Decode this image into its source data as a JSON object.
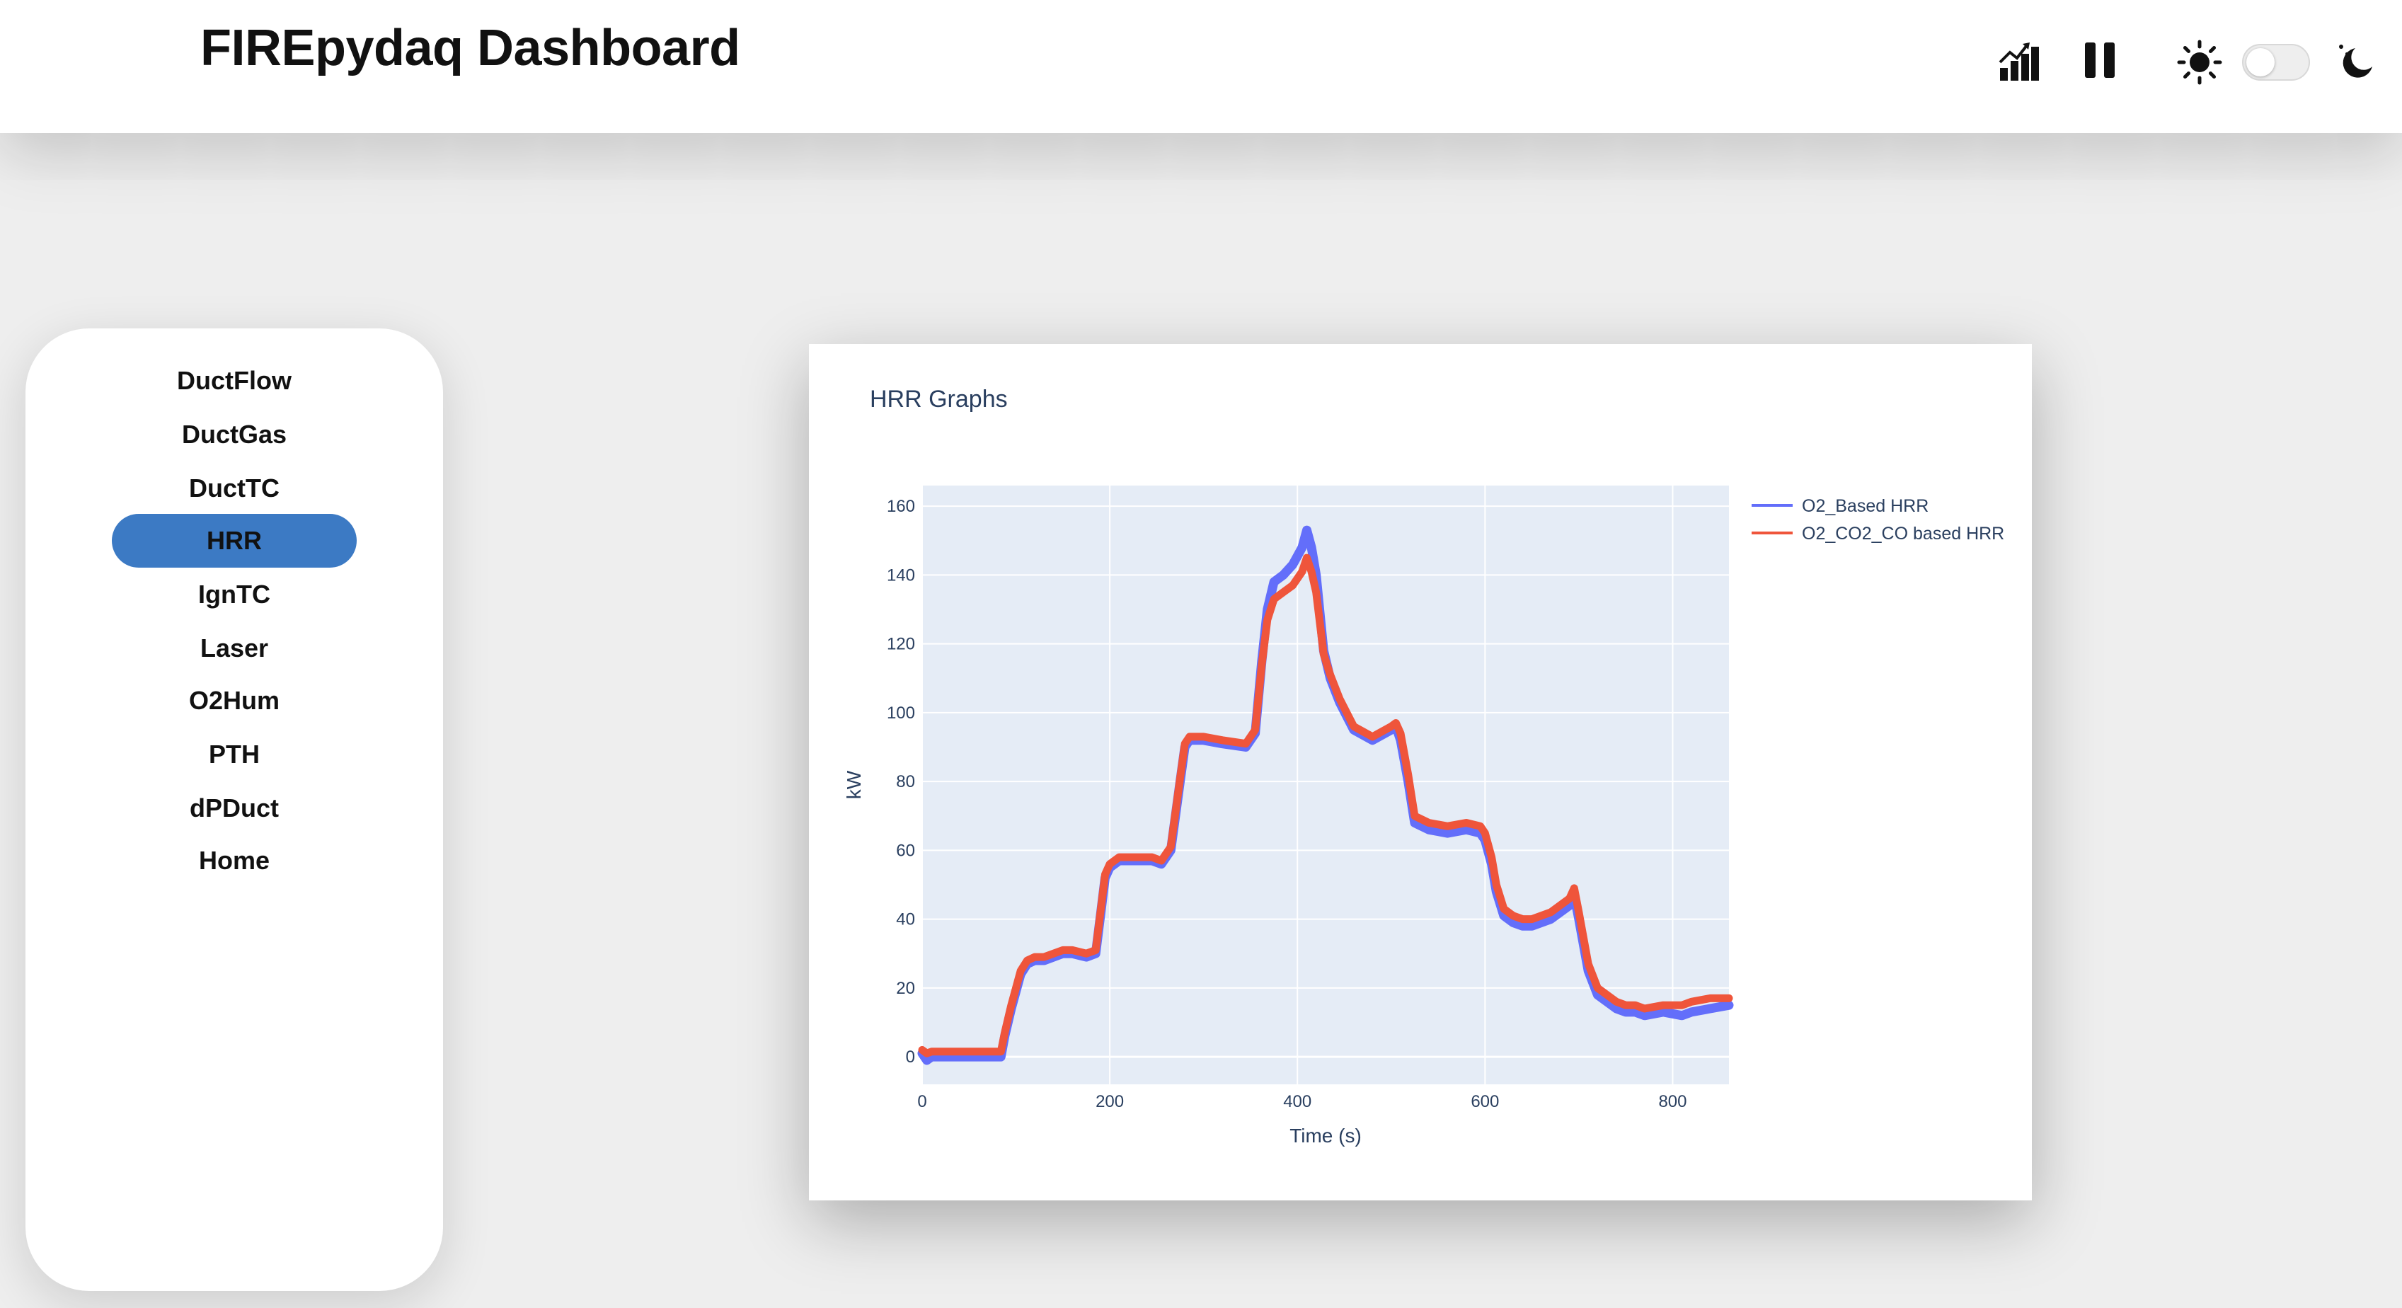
{
  "app": {
    "title": "FIREpydaq Dashboard"
  },
  "header_icons": [
    "bar-chart-icon",
    "pause-icon",
    "sun-icon",
    "theme-toggle",
    "moon-icon"
  ],
  "theme": {
    "dark_mode": false
  },
  "sidebar": {
    "items": [
      {
        "label": "DuctFlow",
        "active": false
      },
      {
        "label": "DuctGas",
        "active": false
      },
      {
        "label": "DuctTC",
        "active": false
      },
      {
        "label": "HRR",
        "active": true
      },
      {
        "label": "IgnTC",
        "active": false
      },
      {
        "label": "Laser",
        "active": false
      },
      {
        "label": "O2Hum",
        "active": false
      },
      {
        "label": "PTH",
        "active": false
      },
      {
        "label": "dPDuct",
        "active": false
      },
      {
        "label": "Home",
        "active": false
      }
    ]
  },
  "colors": {
    "accent": "#3c7ac4",
    "plot_bg": "#e5ecf6",
    "series_o2": "#636efa",
    "series_o2_co2_co": "#ef553b",
    "axis_text": "#2a3f5f"
  },
  "chart_data": {
    "type": "line",
    "title": "HRR Graphs",
    "xlabel": "Time (s)",
    "ylabel": "kW",
    "xlim": [
      0,
      860
    ],
    "ylim": [
      -8,
      166
    ],
    "x_ticks": [
      0,
      200,
      400,
      600,
      800
    ],
    "y_ticks": [
      0,
      20,
      40,
      60,
      80,
      100,
      120,
      140,
      160
    ],
    "grid": true,
    "legend_position": "right-top",
    "series": [
      {
        "name": "O2_Based HRR",
        "color": "#636efa",
        "x": [
          0,
          5,
          10,
          20,
          40,
          60,
          84,
          88,
          95,
          105,
          112,
          120,
          130,
          150,
          160,
          175,
          185,
          190,
          195,
          200,
          210,
          230,
          245,
          255,
          265,
          275,
          280,
          285,
          300,
          320,
          345,
          355,
          362,
          368,
          375,
          385,
          395,
          405,
          410,
          415,
          420,
          428,
          435,
          445,
          460,
          480,
          500,
          505,
          510,
          518,
          525,
          540,
          560,
          580,
          595,
          600,
          607,
          612,
          620,
          630,
          640,
          650,
          670,
          690,
          695,
          700,
          710,
          720,
          740,
          750,
          760,
          770,
          790,
          810,
          820,
          840,
          860
        ],
        "y": [
          1,
          -1,
          0,
          0,
          0,
          0,
          0,
          6,
          14,
          24,
          27,
          28,
          28,
          30,
          30,
          29,
          30,
          41,
          52,
          55,
          57,
          57,
          57,
          56,
          60,
          80,
          90,
          92,
          92,
          91,
          90,
          94,
          115,
          130,
          138,
          140,
          143,
          148,
          153,
          148,
          140,
          118,
          110,
          103,
          95,
          92,
          95,
          96,
          92,
          80,
          68,
          66,
          65,
          66,
          65,
          63,
          56,
          48,
          41,
          39,
          38,
          38,
          40,
          44,
          47,
          40,
          25,
          18,
          14,
          13,
          13,
          12,
          13,
          12,
          13,
          14,
          15
        ]
      },
      {
        "name": "O2_CO2_CO based HRR",
        "color": "#ef553b",
        "x": [
          0,
          5,
          10,
          20,
          40,
          60,
          84,
          88,
          95,
          105,
          112,
          120,
          130,
          150,
          160,
          175,
          185,
          190,
          195,
          200,
          210,
          230,
          245,
          255,
          265,
          275,
          280,
          285,
          300,
          320,
          345,
          355,
          362,
          368,
          375,
          385,
          395,
          405,
          410,
          415,
          420,
          428,
          435,
          445,
          460,
          480,
          500,
          505,
          510,
          518,
          525,
          540,
          560,
          580,
          595,
          600,
          607,
          612,
          620,
          630,
          640,
          650,
          670,
          690,
          695,
          700,
          710,
          720,
          740,
          750,
          760,
          770,
          790,
          810,
          820,
          840,
          860
        ],
        "y": [
          2,
          1,
          1.5,
          1.5,
          1.5,
          1.5,
          1.5,
          7,
          15,
          25,
          28,
          29,
          29,
          31,
          31,
          30,
          31,
          42,
          53,
          56,
          58,
          58,
          58,
          57,
          61,
          81,
          91,
          93,
          93,
          92,
          91,
          95,
          114,
          127,
          133,
          135,
          137,
          141,
          145,
          141,
          135,
          117,
          111,
          104,
          96,
          93,
          96,
          97,
          94,
          82,
          70,
          68,
          67,
          68,
          67,
          65,
          58,
          50,
          43,
          41,
          40,
          40,
          42,
          46,
          49,
          42,
          27,
          20,
          16,
          15,
          15,
          14,
          15,
          15,
          16,
          17,
          17
        ]
      }
    ]
  }
}
